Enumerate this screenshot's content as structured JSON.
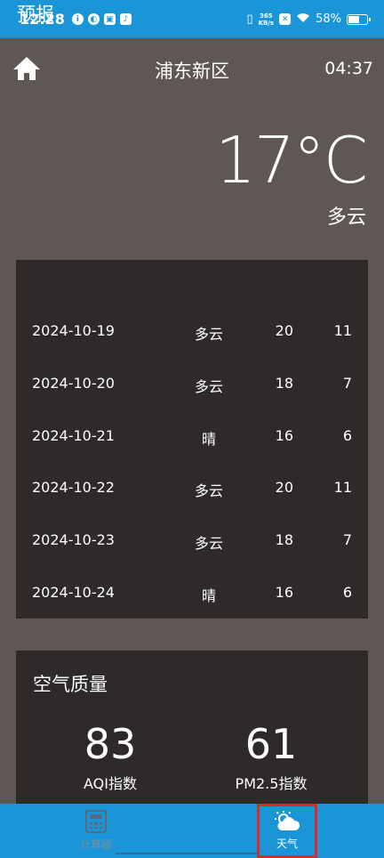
{
  "status_bar": {
    "time": "12:28",
    "net_speed_value": "365",
    "net_speed_unit": "KB/s",
    "battery": "58%",
    "battery_level": 0.58
  },
  "header": {
    "city": "浦东新区",
    "clock": "04:37"
  },
  "current": {
    "temperature": "17°C",
    "condition": "多云"
  },
  "forecast": {
    "title": "预报",
    "rows": [
      {
        "date": "2024-10-19",
        "cond": "多云",
        "high": "20",
        "low": "11"
      },
      {
        "date": "2024-10-20",
        "cond": "多云",
        "high": "18",
        "low": "7"
      },
      {
        "date": "2024-10-21",
        "cond": "晴",
        "high": "16",
        "low": "6"
      },
      {
        "date": "2024-10-22",
        "cond": "多云",
        "high": "20",
        "low": "11"
      },
      {
        "date": "2024-10-23",
        "cond": "多云",
        "high": "18",
        "low": "7"
      },
      {
        "date": "2024-10-24",
        "cond": "晴",
        "high": "16",
        "low": "6"
      }
    ]
  },
  "air_quality": {
    "title": "空气质量",
    "aqi_value": "83",
    "aqi_label": "AQI指数",
    "pm25_value": "61",
    "pm25_label": "PM2.5指数"
  },
  "bottom_nav": {
    "calculator_label": "计算器",
    "weather_label": "天气"
  },
  "colors": {
    "status_bar": "#1a96d8",
    "background": "#5f5753",
    "card": "#2d2a29",
    "highlight": "#e0252b"
  }
}
